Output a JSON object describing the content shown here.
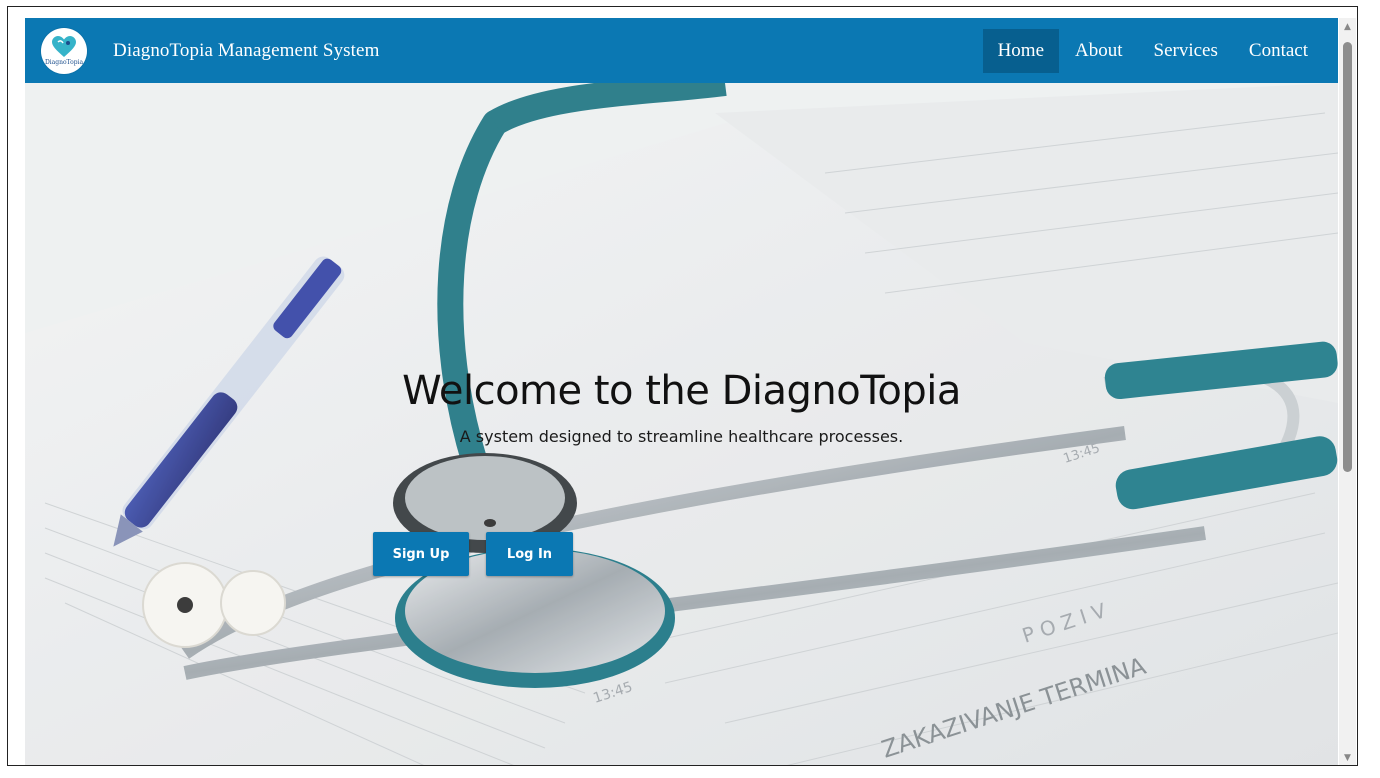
{
  "app": {
    "brand_title": "DiagnoTopia Management System",
    "logo_text": "DiagnoTopia"
  },
  "nav": {
    "items": [
      {
        "label": "Home",
        "active": true
      },
      {
        "label": "About",
        "active": false
      },
      {
        "label": "Services",
        "active": false
      },
      {
        "label": "Contact",
        "active": false
      }
    ]
  },
  "hero": {
    "title": "Welcome to the DiagnoTopia",
    "subtitle": "A system designed to streamline healthcare processes.",
    "signup_label": "Sign Up",
    "login_label": "Log In"
  },
  "colors": {
    "navbar": "#0b78b3",
    "nav_active": "#075f8f",
    "button": "#0b78b3"
  },
  "icons": {
    "logo": "heart-logo-icon",
    "scroll_up": "arrow-up-icon",
    "scroll_down": "arrow-down-icon"
  }
}
